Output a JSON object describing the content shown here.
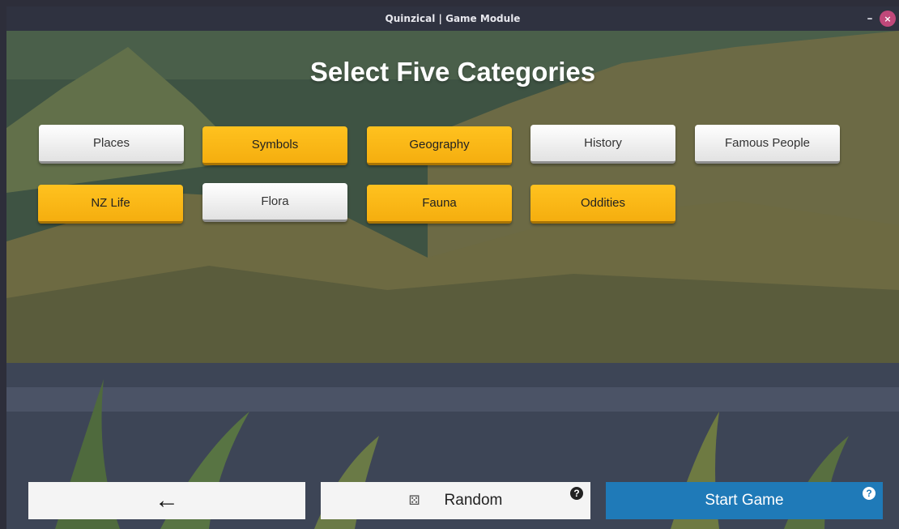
{
  "window": {
    "title": "Quinzical | Game Module",
    "minimize_symbol": "–",
    "close_symbol": "×"
  },
  "page": {
    "title": "Select Five Categories"
  },
  "categories": [
    {
      "label": "Places",
      "selected": false
    },
    {
      "label": "Symbols",
      "selected": true
    },
    {
      "label": "Geography",
      "selected": true
    },
    {
      "label": "History",
      "selected": false
    },
    {
      "label": "Famous People",
      "selected": false
    },
    {
      "label": "NZ Life",
      "selected": true
    },
    {
      "label": "Flora",
      "selected": false
    },
    {
      "label": "Fauna",
      "selected": true
    },
    {
      "label": "Oddities",
      "selected": true
    }
  ],
  "footer": {
    "back_symbol": "←",
    "random_label": "Random",
    "start_label": "Start Game",
    "help_symbol": "?",
    "dice_symbol": "⚄"
  },
  "colors": {
    "selected": "#f9b816",
    "unselected": "#f2f2f2",
    "start": "#1f7ab8"
  }
}
